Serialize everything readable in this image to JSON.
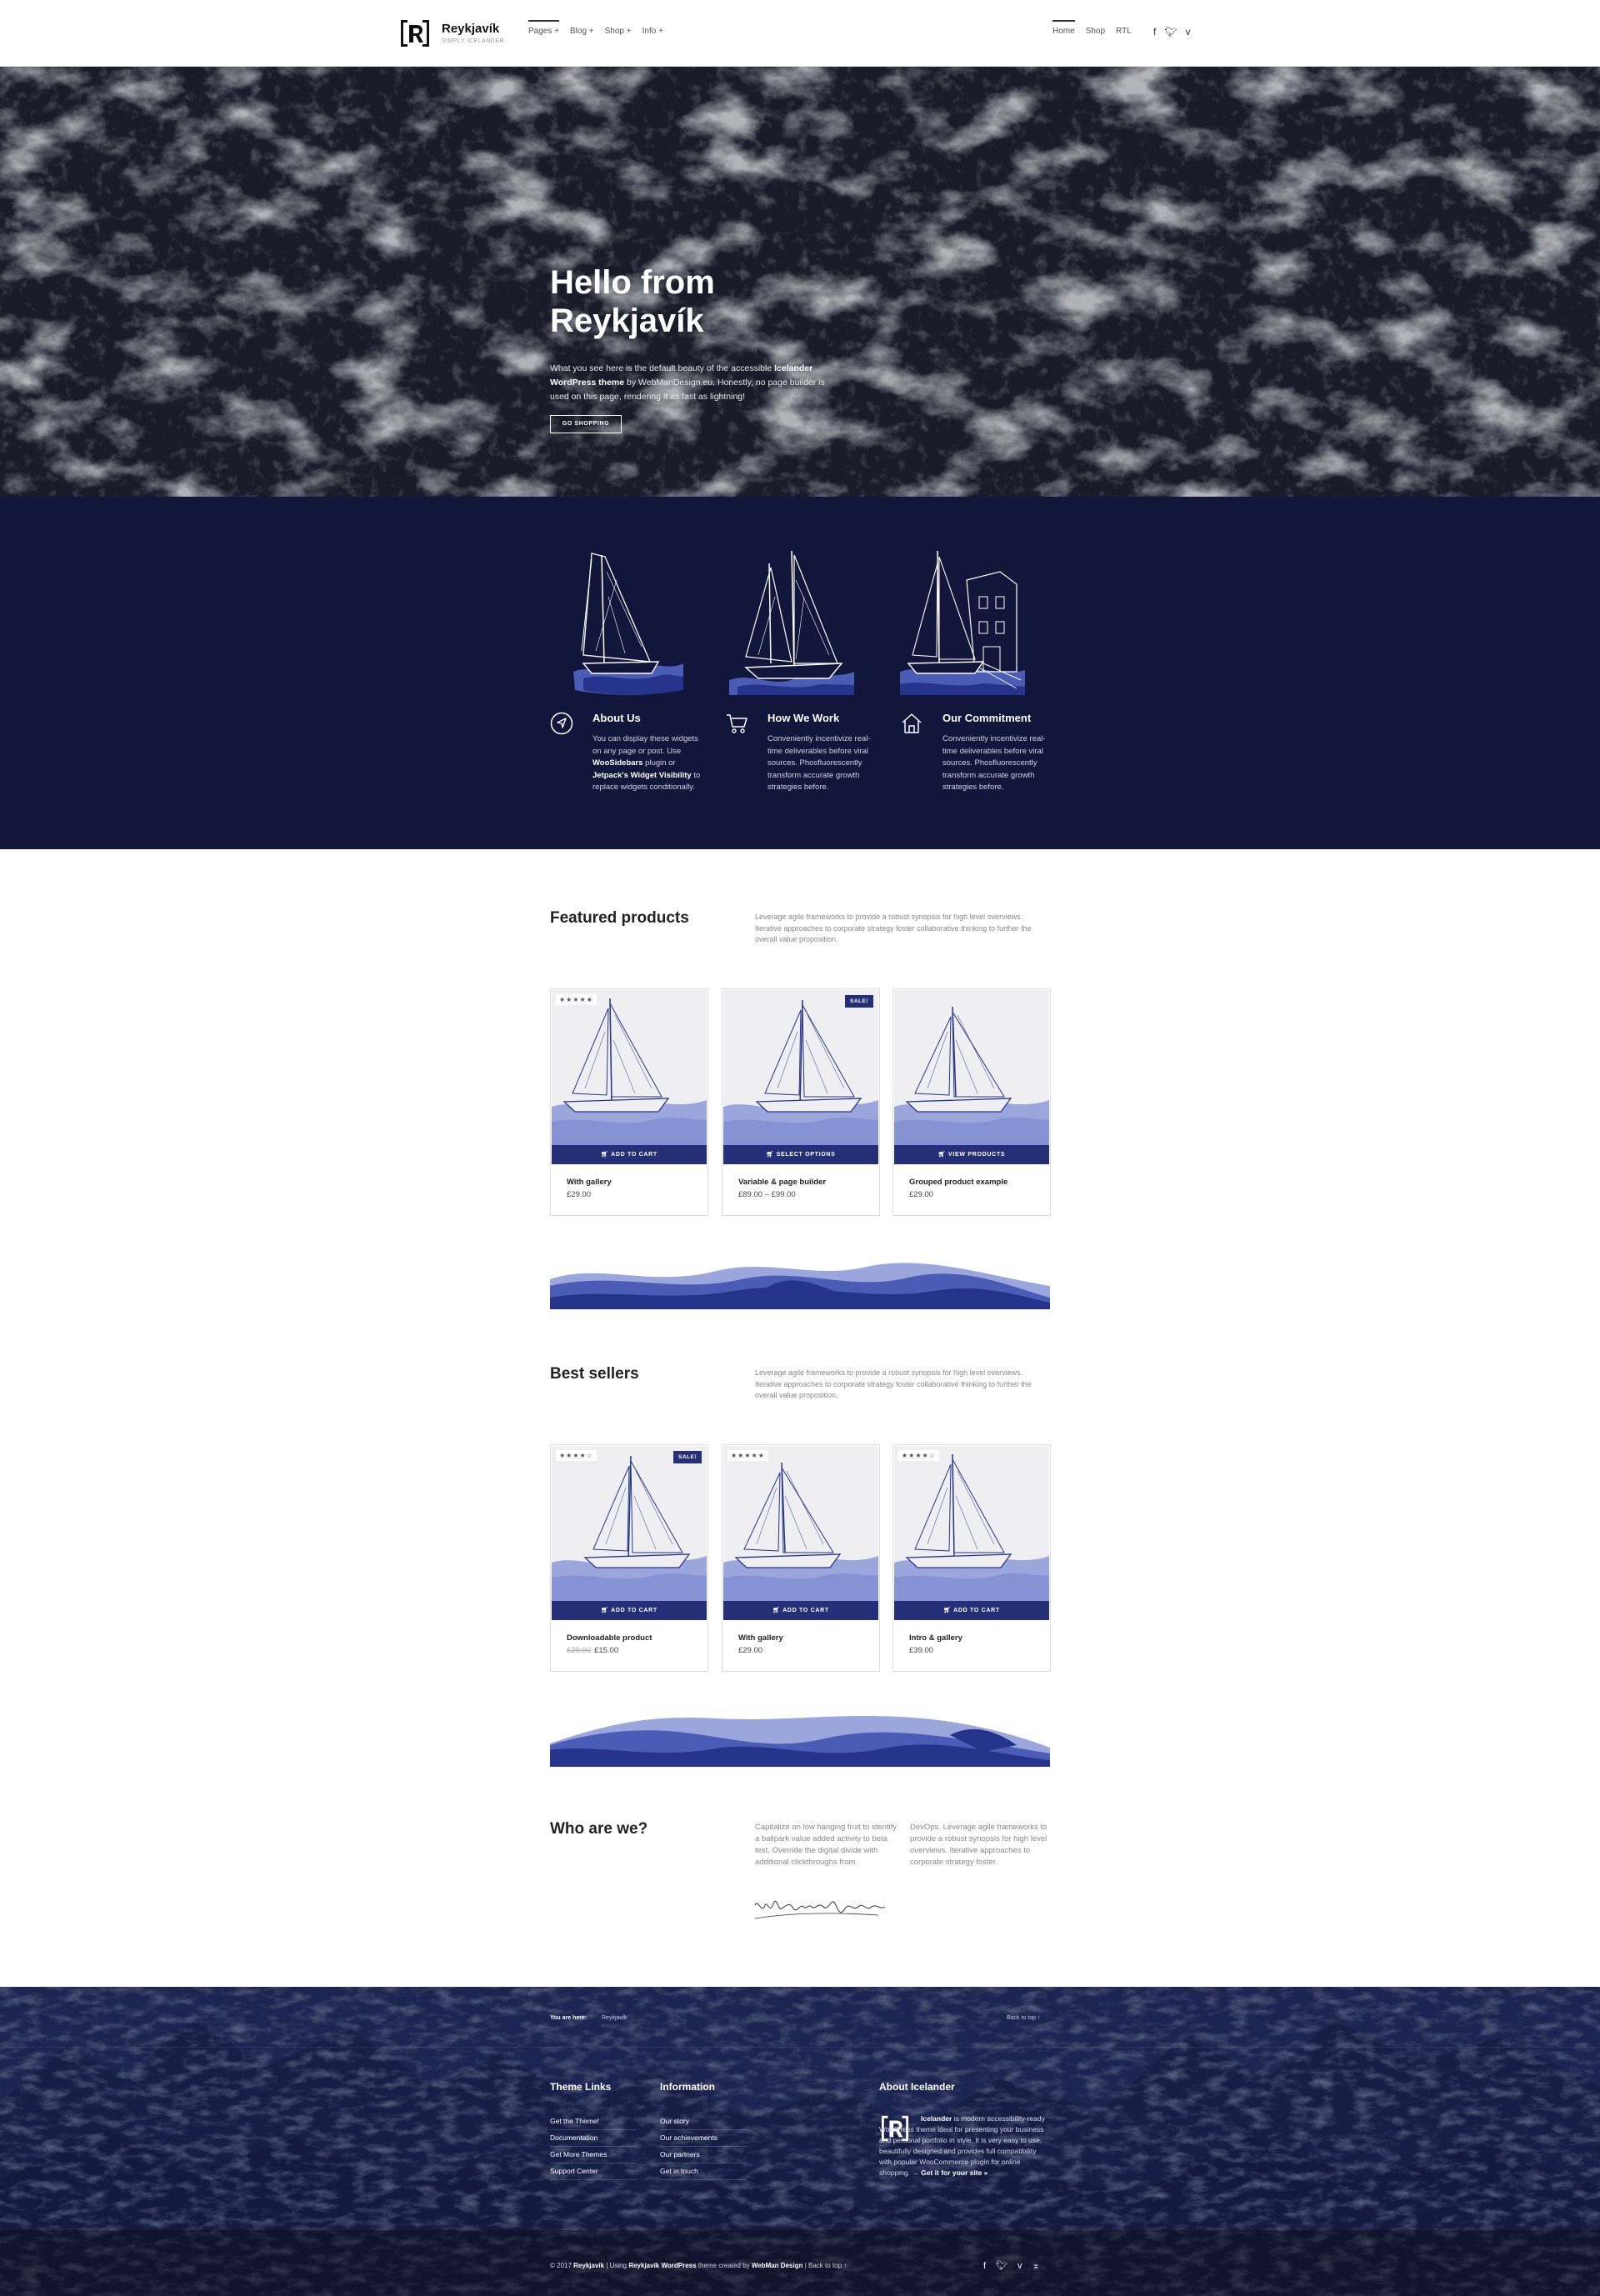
{
  "header": {
    "brand": "Reykjavík",
    "tagline": "SIMPLY ICELANDER",
    "menu": [
      "Pages +",
      "Blog +",
      "Shop +",
      "Info +"
    ],
    "right_menu": [
      "Home",
      "Shop",
      "RTL"
    ],
    "social": [
      "facebook-icon",
      "twitter-icon",
      "vimeo-icon"
    ]
  },
  "hero": {
    "title_line1": "Hello from",
    "title_line2": "Reykjavík",
    "text_a": "What you see here is the default beauty of the accessible",
    "text_b": "Icelander WordPress theme",
    "text_c": "by WebManDesign.eu. Honestly, no page builder is used on this page, rendering it as fast as lightning!",
    "button": "GO SHOPPING"
  },
  "features": [
    {
      "icon": "navigation-arrow-icon",
      "title": "About Us",
      "p1": "You can display these widgets on any page or post. Use",
      "b1": "WooSidebars",
      "p2": "plugin or",
      "b2": "Jetpack's Widget Visibility",
      "p3": "to replace widgets conditionally."
    },
    {
      "icon": "cart-icon",
      "title": "How We Work",
      "text": "Conveniently incentivize real-time deliverables before viral sources. Phosfluorescently transform accurate growth strategies before."
    },
    {
      "icon": "home-icon",
      "title": "Our Commitment",
      "text": "Conveniently incentivize real-time deliverables before viral sources. Phosfluorescently transform accurate growth strategies before."
    }
  ],
  "featured": {
    "title": "Featured products",
    "text": "Leverage agile frameworks to provide a robust synopsis for high level overviews. Iterative approaches to corporate strategy foster collaborative thinking to further the overall value proposition.",
    "products": [
      {
        "title": "With gallery",
        "price": "£29.00",
        "button": "ADD TO CART",
        "stars": "★★★★★",
        "sale": ""
      },
      {
        "title": "Variable & page builder",
        "price": "£89.00 – £99.00",
        "button": "SELECT OPTIONS",
        "stars": "",
        "sale": "SALE!"
      },
      {
        "title": "Grouped product example",
        "price": "£29.00",
        "button": "VIEW PRODUCTS",
        "stars": "",
        "sale": ""
      }
    ]
  },
  "bestsellers": {
    "title": "Best sellers",
    "text": "Leverage agile frameworks to provide a robust synopsis for high level overviews. Iterative approaches to corporate strategy foster collaborative thinking to further the overall value proposition.",
    "products": [
      {
        "title": "Downloadable product",
        "old_price": "£29.00",
        "price": "£15.00",
        "button": "ADD TO CART",
        "stars": "★★★★☆",
        "sale": "SALE!"
      },
      {
        "title": "With gallery",
        "old_price": "",
        "price": "£29.00",
        "button": "ADD TO CART",
        "stars": "★★★★★",
        "sale": ""
      },
      {
        "title": "Intro & gallery",
        "old_price": "",
        "price": "£39.00",
        "button": "ADD TO CART",
        "stars": "★★★★☆",
        "sale": ""
      }
    ]
  },
  "who": {
    "title": "Who are we?",
    "col1": "Capitalize on low hanging fruit to identify a ballpark value added activity to beta test. Override the digital divide with additional clickthroughs from",
    "col2": "DevOps. Leverage agile frameworks to provide a robust synopsis for high level overviews. Iterative approaches to corporate strategy foster.",
    "signature": "WebManDesign.eu"
  },
  "footer": {
    "you_are_here": "You are here:",
    "crumb": "Reykjavík",
    "back_top": "Back to top ↑",
    "theme_links_title": "Theme Links",
    "theme_links": [
      "Get the Theme!",
      "Documentation",
      "Get More Themes",
      "Support Center"
    ],
    "info_title": "Information",
    "info_links": [
      "Our story",
      "Our achievements",
      "Our partners",
      "Get in touch"
    ],
    "about_title": "About Icelander",
    "about_b": "Icelander",
    "about_text": "is modern accessibility-ready WordPress theme ideal for presenting your business and personal portfolio in style. It is very easy to use, beautifully designed and provides full compatibility with popular WooCommerce plugin for online shopping. →",
    "about_link": "Get it for your site »",
    "copy_a": "© 2017",
    "copy_b": "Reykjavík",
    "copy_c": "| Using",
    "copy_d": "Reykjavík WordPress",
    "copy_e": "theme created by",
    "copy_f": "WebMan Design",
    "copy_g": "| Back to top ↑",
    "social": [
      "facebook-icon",
      "twitter-icon",
      "vimeo-icon",
      "up-arrow-icon"
    ]
  },
  "colors": {
    "navy": "#11163a",
    "accent": "#242f78",
    "wave_dark": "#25348a",
    "wave_mid": "#4a5cb6",
    "wave_light": "#9aa6dc"
  }
}
